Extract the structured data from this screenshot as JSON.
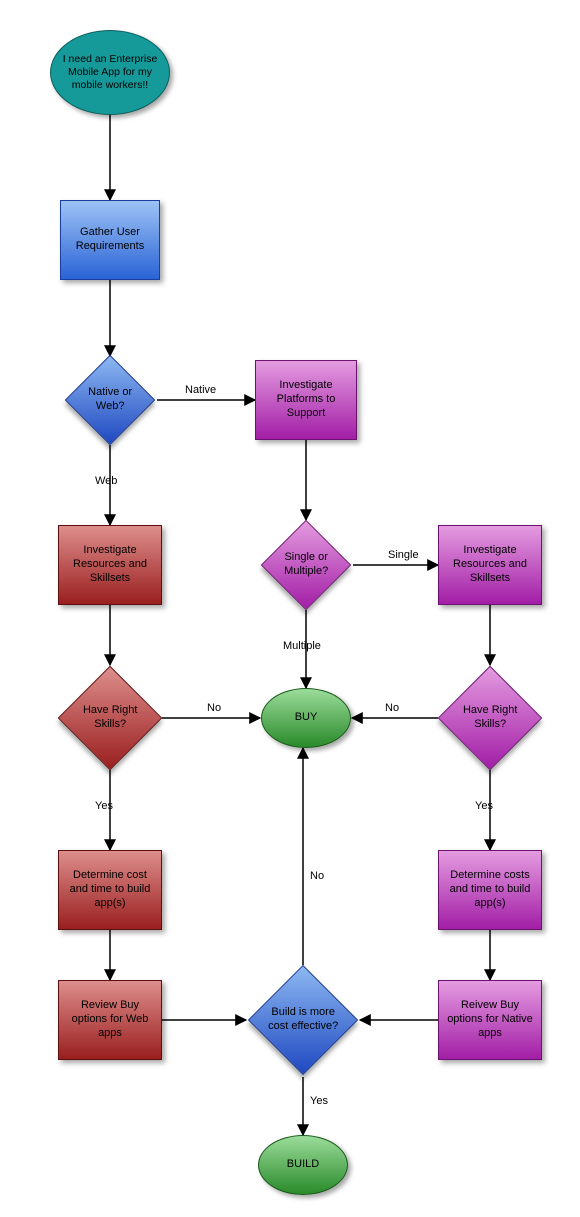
{
  "chart_data": {
    "type": "flowchart",
    "nodes": [
      {
        "id": "start",
        "shape": "ellipse",
        "color": "teal",
        "text": "I need an Enterprise Mobile App for my mobile workers!!"
      },
      {
        "id": "gather",
        "shape": "rect",
        "color": "blue",
        "text": "Gather User Requirements"
      },
      {
        "id": "nativeOrWeb",
        "shape": "diamond",
        "color": "blue",
        "text": "Native or Web?"
      },
      {
        "id": "invPlatforms",
        "shape": "rect",
        "color": "purple",
        "text": "Investigate Platforms to Support"
      },
      {
        "id": "invResWeb",
        "shape": "rect",
        "color": "red",
        "text": "Investigate Resources and Skillsets"
      },
      {
        "id": "singleOrMulti",
        "shape": "diamond",
        "color": "purple",
        "text": "Single or Multiple?"
      },
      {
        "id": "invResNative",
        "shape": "rect",
        "color": "purple",
        "text": "Investigate Resources and Skillsets"
      },
      {
        "id": "skillsWeb",
        "shape": "diamond",
        "color": "red",
        "text": "Have Right Skills?"
      },
      {
        "id": "buy",
        "shape": "ellipse",
        "color": "green",
        "text": "BUY"
      },
      {
        "id": "skillsNative",
        "shape": "diamond",
        "color": "purple",
        "text": "Have Right Skills?"
      },
      {
        "id": "costWeb",
        "shape": "rect",
        "color": "red",
        "text": "Determine cost and time to build app(s)"
      },
      {
        "id": "costNative",
        "shape": "rect",
        "color": "purple",
        "text": "Determine costs and time to build app(s)"
      },
      {
        "id": "reviewWeb",
        "shape": "rect",
        "color": "red",
        "text": "Review Buy options for Web apps"
      },
      {
        "id": "reviewNative",
        "shape": "rect",
        "color": "purple",
        "text": "Reivew Buy options for Native apps"
      },
      {
        "id": "costEffective",
        "shape": "diamond",
        "color": "blue",
        "text": "Build is more cost effective?"
      },
      {
        "id": "build",
        "shape": "ellipse",
        "color": "green",
        "text": "BUILD"
      }
    ],
    "edges": [
      {
        "from": "start",
        "to": "gather",
        "label": ""
      },
      {
        "from": "gather",
        "to": "nativeOrWeb",
        "label": ""
      },
      {
        "from": "nativeOrWeb",
        "to": "invPlatforms",
        "label": "Native"
      },
      {
        "from": "nativeOrWeb",
        "to": "invResWeb",
        "label": "Web"
      },
      {
        "from": "invPlatforms",
        "to": "singleOrMulti",
        "label": ""
      },
      {
        "from": "singleOrMulti",
        "to": "invResNative",
        "label": "Single"
      },
      {
        "from": "singleOrMulti",
        "to": "buy",
        "label": "Multiple"
      },
      {
        "from": "invResWeb",
        "to": "skillsWeb",
        "label": ""
      },
      {
        "from": "invResNative",
        "to": "skillsNative",
        "label": ""
      },
      {
        "from": "skillsWeb",
        "to": "buy",
        "label": "No"
      },
      {
        "from": "skillsWeb",
        "to": "costWeb",
        "label": "Yes"
      },
      {
        "from": "skillsNative",
        "to": "buy",
        "label": "No"
      },
      {
        "from": "skillsNative",
        "to": "costNative",
        "label": "Yes"
      },
      {
        "from": "costWeb",
        "to": "reviewWeb",
        "label": ""
      },
      {
        "from": "costNative",
        "to": "reviewNative",
        "label": ""
      },
      {
        "from": "reviewWeb",
        "to": "costEffective",
        "label": ""
      },
      {
        "from": "reviewNative",
        "to": "costEffective",
        "label": ""
      },
      {
        "from": "costEffective",
        "to": "buy",
        "label": "No"
      },
      {
        "from": "costEffective",
        "to": "build",
        "label": "Yes"
      }
    ]
  },
  "nodes": {
    "start": "I need an Enterprise Mobile App for my mobile workers!!",
    "gather": "Gather User Requirements",
    "nativeOrWeb": "Native or Web?",
    "invPlatforms": "Investigate Platforms to Support",
    "invResWeb": "Investigate Resources and Skillsets",
    "singleOrMulti": "Single or Multiple?",
    "invResNative": "Investigate Resources and Skillsets",
    "skillsWeb": "Have Right Skills?",
    "buy": "BUY",
    "skillsNative": "Have Right Skills?",
    "costWeb": "Determine cost and time to build app(s)",
    "costNative": "Determine costs and time to build app(s)",
    "reviewWeb": "Review Buy options for Web apps",
    "reviewNative": "Reivew Buy options for Native apps",
    "costEffective": "Build is more cost effective?",
    "build": "BUILD"
  },
  "labels": {
    "native": "Native",
    "web": "Web",
    "single": "Single",
    "multiple": "Multiple",
    "no": "No",
    "yes": "Yes"
  }
}
